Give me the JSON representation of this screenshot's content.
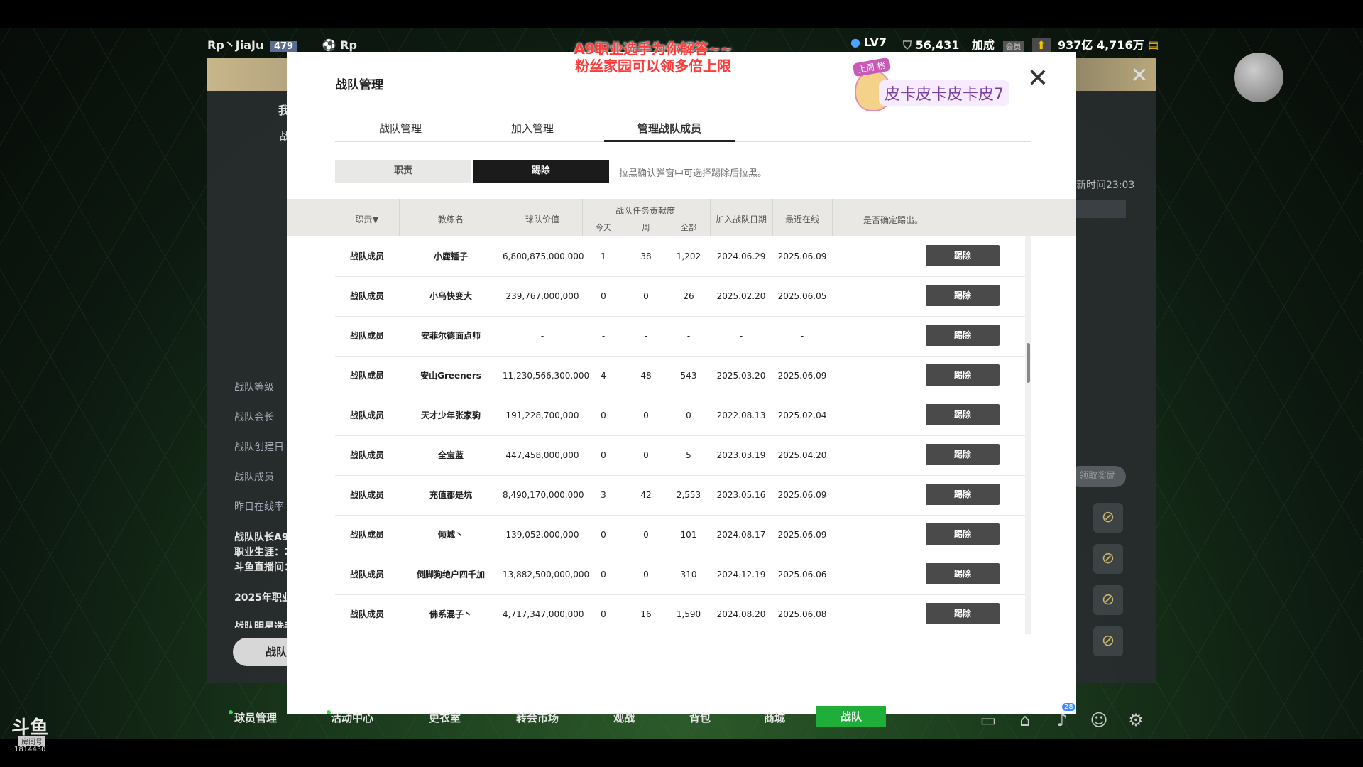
{
  "hud": {
    "player": "Rp丶JiaJu",
    "player_level": "479",
    "club": "Rp",
    "vip": "LV7",
    "points": "56,431",
    "bonus_label": "加成",
    "member_label": "会员",
    "coins": "937亿 4,716万"
  },
  "promo": {
    "line1": "A9职业选手为你解答~~",
    "line2": "粉丝家园可以领多倍上限"
  },
  "sticker": {
    "tag": "上周\n榜",
    "name": "皮卡皮卡皮卡皮7"
  },
  "underlay": {
    "left_labels": [
      "战队等级",
      "战队会长",
      "战队创建日",
      "战队成员",
      "昨日在线率"
    ],
    "left_texts": [
      "战队队长A9.",
      "职业生涯：2",
      "斗鱼直播间：",
      "2025年职业",
      "战队明星选手"
    ],
    "left_button": "战队",
    "right_time": "新时间23:03",
    "right_pill": "领取奖励",
    "tab_fragment": "我",
    "subtab_fragment": "战"
  },
  "modal": {
    "title": "战队管理",
    "tabs": [
      "战队管理",
      "加入管理",
      "管理战队成员"
    ],
    "segments": [
      "职责",
      "踢除"
    ],
    "hint": "拉黑确认弹窗中可选择踢除后拉黑。",
    "headers": {
      "role": "职责▼",
      "coach": "教练名",
      "value": "球队价值",
      "contrib": "战队任务贡献度",
      "today": "今天",
      "week": "周",
      "all": "全部",
      "joined": "加入战队日期",
      "online": "最近在线",
      "confirm": "是否确定踢出。"
    },
    "rows": [
      {
        "role": "战队成员",
        "coach": "小鹿锤子",
        "value": "6,800,875,000,000",
        "today": "1",
        "week": "38",
        "all": "1,202",
        "joined": "2024.06.29",
        "online": "2025.06.09",
        "btn": "踢除"
      },
      {
        "role": "战队成员",
        "coach": "小乌快变大",
        "value": "239,767,000,000",
        "today": "0",
        "week": "0",
        "all": "26",
        "joined": "2025.02.20",
        "online": "2025.06.05",
        "btn": "踢除"
      },
      {
        "role": "战队成员",
        "coach": "安菲尔德面点师",
        "value": "-",
        "today": "-",
        "week": "-",
        "all": "-",
        "joined": "-",
        "online": "-",
        "btn": "踢除"
      },
      {
        "role": "战队成员",
        "coach": "安山Greeners",
        "value": "11,230,566,300,000",
        "today": "4",
        "week": "48",
        "all": "543",
        "joined": "2025.03.20",
        "online": "2025.06.09",
        "btn": "踢除"
      },
      {
        "role": "战队成员",
        "coach": "天才少年张家驹",
        "value": "191,228,700,000",
        "today": "0",
        "week": "0",
        "all": "0",
        "joined": "2022.08.13",
        "online": "2025.02.04",
        "btn": "踢除"
      },
      {
        "role": "战队成员",
        "coach": "全宝蓝",
        "value": "447,458,000,000",
        "today": "0",
        "week": "0",
        "all": "5",
        "joined": "2023.03.19",
        "online": "2025.04.20",
        "btn": "踢除"
      },
      {
        "role": "战队成员",
        "coach": "充值都是坑",
        "value": "8,490,170,000,000",
        "today": "3",
        "week": "42",
        "all": "2,553",
        "joined": "2023.05.16",
        "online": "2025.06.09",
        "btn": "踢除"
      },
      {
        "role": "战队成员",
        "coach": "倾城丶",
        "value": "139,052,000,000",
        "today": "0",
        "week": "0",
        "all": "101",
        "joined": "2024.08.17",
        "online": "2025.06.09",
        "btn": "踢除"
      },
      {
        "role": "战队成员",
        "coach": "倒脚狗绝户四千加",
        "value": "13,882,500,000,000",
        "today": "0",
        "week": "0",
        "all": "310",
        "joined": "2024.12.19",
        "online": "2025.06.06",
        "btn": "踢除"
      },
      {
        "role": "战队成员",
        "coach": "佛系混子丶",
        "value": "4,717,347,000,000",
        "today": "0",
        "week": "16",
        "all": "1,590",
        "joined": "2024.08.20",
        "online": "2025.06.08",
        "btn": "踢除"
      }
    ]
  },
  "bottom_nav": {
    "items": [
      "球员管理",
      "活动中心",
      "更衣室",
      "转会市场",
      "观战",
      "背包",
      "商城",
      "战队"
    ],
    "active_index": 7,
    "badge_count": "28"
  },
  "logo": {
    "brand": "斗鱼",
    "room_label": "房间号",
    "room": "1814430"
  },
  "colors": {
    "active_nav": "#1fae3a",
    "kick_button": "#4a4a4a",
    "promo_text": "#ff3c3c"
  }
}
